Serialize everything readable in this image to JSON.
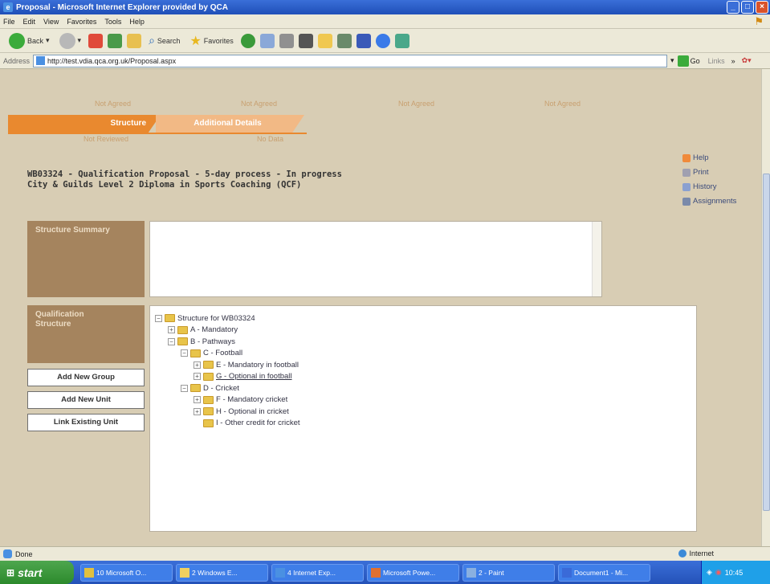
{
  "window": {
    "title": "Proposal - Microsoft Internet Explorer provided by QCA"
  },
  "menu": [
    "File",
    "Edit",
    "View",
    "Favorites",
    "Tools",
    "Help"
  ],
  "toolbar": {
    "back_label": "Back",
    "search_label": "Search",
    "favorites_label": "Favorites"
  },
  "address": {
    "label": "Address",
    "url": "http://test.vdia.qca.org.uk/Proposal.aspx",
    "go_label": "Go",
    "links_label": "Links"
  },
  "steps_top": [
    "Not Agreed",
    "Not Agreed",
    "Not Agreed",
    "Not Agreed"
  ],
  "tabs": [
    {
      "label": "Structure"
    },
    {
      "label": "Additional Details"
    }
  ],
  "steps_bottom": [
    "Not Reviewed",
    "No Data"
  ],
  "heading": {
    "line1": "WB03324 - Qualification Proposal - 5-day process - In progress",
    "line2": "City & Guilds Level 2 Diploma in Sports Coaching (QCF)"
  },
  "sidelinks": {
    "help": "Help",
    "print": "Print",
    "history": "History",
    "assignments": "Assignments"
  },
  "labels": {
    "summary": "Structure Summary",
    "qual_structure_1": "Qualification",
    "qual_structure_2": "Structure"
  },
  "buttons": {
    "add_group": "Add New Group",
    "add_unit": "Add New Unit",
    "link_unit": "Link Existing Unit"
  },
  "tree": {
    "root": "Structure for WB03324",
    "a": "A - Mandatory",
    "b": "B - Pathways",
    "c": "C - Football",
    "e": "E - Mandatory in football",
    "g": "G - Optional in football",
    "d": "D - Cricket",
    "f": "F - Mandatory cricket",
    "h": "H - Optional in cricket",
    "i": "I - Other credit for cricket"
  },
  "status": {
    "left": "Done",
    "zone": "Internet"
  },
  "taskbar": {
    "start": "start",
    "tasks": [
      "10 Microsoft O...",
      "2 Windows E...",
      "4 Internet Exp...",
      "Microsoft Powe...",
      "2 - Paint",
      "Document1 - Mi..."
    ],
    "time": "10:45"
  }
}
